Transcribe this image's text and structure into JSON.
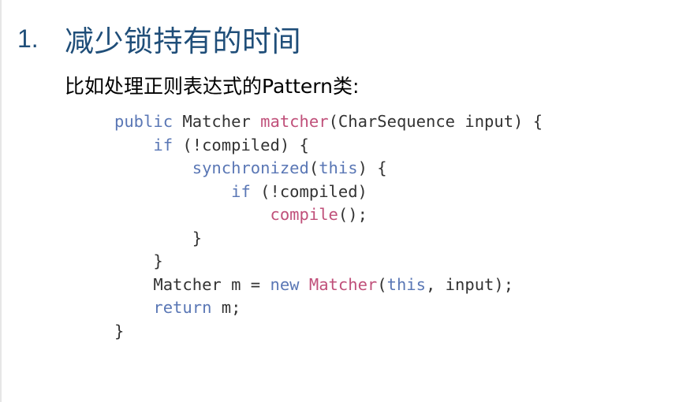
{
  "heading": {
    "number": "1.",
    "text": "减少锁持有的时间"
  },
  "subtitle": "比如处理正则表达式的Pattern类:",
  "code": {
    "lines": [
      [
        {
          "t": "public",
          "c": "kw"
        },
        {
          "t": " Matcher ",
          "c": "tx"
        },
        {
          "t": "matcher",
          "c": "fn"
        },
        {
          "t": "(CharSequence input) {",
          "c": "tx"
        }
      ],
      [
        {
          "t": "    ",
          "c": "tx"
        },
        {
          "t": "if",
          "c": "kw"
        },
        {
          "t": " (!compiled) {",
          "c": "tx"
        }
      ],
      [
        {
          "t": "        ",
          "c": "tx"
        },
        {
          "t": "synchronized",
          "c": "kw"
        },
        {
          "t": "(",
          "c": "tx"
        },
        {
          "t": "this",
          "c": "kw"
        },
        {
          "t": ") {",
          "c": "tx"
        }
      ],
      [
        {
          "t": "            ",
          "c": "tx"
        },
        {
          "t": "if",
          "c": "kw"
        },
        {
          "t": " (!compiled)",
          "c": "tx"
        }
      ],
      [
        {
          "t": "                ",
          "c": "tx"
        },
        {
          "t": "compile",
          "c": "fn"
        },
        {
          "t": "();",
          "c": "tx"
        }
      ],
      [
        {
          "t": "        }",
          "c": "tx"
        }
      ],
      [
        {
          "t": "    }",
          "c": "tx"
        }
      ],
      [
        {
          "t": "    Matcher m = ",
          "c": "tx"
        },
        {
          "t": "new",
          "c": "kw"
        },
        {
          "t": " ",
          "c": "tx"
        },
        {
          "t": "Matcher",
          "c": "fn"
        },
        {
          "t": "(",
          "c": "tx"
        },
        {
          "t": "this",
          "c": "kw"
        },
        {
          "t": ", input);",
          "c": "tx"
        }
      ],
      [
        {
          "t": "    ",
          "c": "tx"
        },
        {
          "t": "return",
          "c": "kw"
        },
        {
          "t": " m;",
          "c": "tx"
        }
      ],
      [
        {
          "t": "}",
          "c": "tx"
        }
      ]
    ]
  },
  "colors": {
    "heading": "#1f4e79",
    "keyword": "#5a77b5",
    "function": "#c0507a",
    "text": "#333333"
  }
}
